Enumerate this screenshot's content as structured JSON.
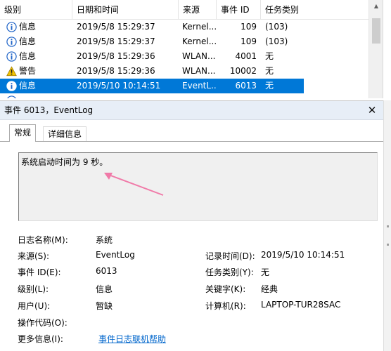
{
  "list": {
    "headers": {
      "level": "级别",
      "datetime": "日期和时间",
      "source": "来源",
      "event_id": "事件 ID",
      "category": "任务类别"
    },
    "rows": [
      {
        "level": "信息",
        "level_icon": "info-icon",
        "datetime": "2019/5/8 15:29:37",
        "source": "Kernel...",
        "event_id": "109",
        "category": "(103)"
      },
      {
        "level": "信息",
        "level_icon": "info-icon",
        "datetime": "2019/5/8 15:29:37",
        "source": "Kernel...",
        "event_id": "109",
        "category": "(103)"
      },
      {
        "level": "信息",
        "level_icon": "info-icon",
        "datetime": "2019/5/8 15:29:36",
        "source": "WLAN...",
        "event_id": "4001",
        "category": "无"
      },
      {
        "level": "警告",
        "level_icon": "warning-icon",
        "datetime": "2019/5/8 15:29:36",
        "source": "WLAN...",
        "event_id": "10002",
        "category": "无"
      },
      {
        "level": "信息",
        "level_icon": "info-icon",
        "datetime": "2019/5/10 10:14:51",
        "source": "EventL...",
        "event_id": "6013",
        "category": "无",
        "selected": true
      }
    ]
  },
  "detail": {
    "title": "事件 6013，EventLog",
    "close_glyph": "✕",
    "tabs": [
      "常规",
      "详细信息"
    ],
    "description": "系统启动时间为 9 秒。",
    "fields_left": [
      {
        "label": "日志名称(M):",
        "value": "系统"
      },
      {
        "label": "来源(S):",
        "value": "EventLog"
      },
      {
        "label": "事件 ID(E):",
        "value": "6013"
      },
      {
        "label": "级别(L):",
        "value": "信息"
      },
      {
        "label": "用户(U):",
        "value": "暂缺"
      },
      {
        "label": "操作代码(O):",
        "value": ""
      },
      {
        "label": "更多信息(I):",
        "value": "事件日志联机帮助"
      }
    ],
    "fields_right": [
      {
        "label": "记录时间(D):",
        "value": "2019/5/10 10:14:51"
      },
      {
        "label": "任务类别(Y):",
        "value": "无"
      },
      {
        "label": "关键字(K):",
        "value": "经典"
      },
      {
        "label": "计算机(R):",
        "value": "LAPTOP-TUR28SAC"
      }
    ]
  },
  "colors": {
    "selection": "#0078d7",
    "info_icon": "#1f64c8",
    "warning_icon": "#f2c200",
    "annotation_arrow": "#f07aa8",
    "link": "#0066cc"
  }
}
